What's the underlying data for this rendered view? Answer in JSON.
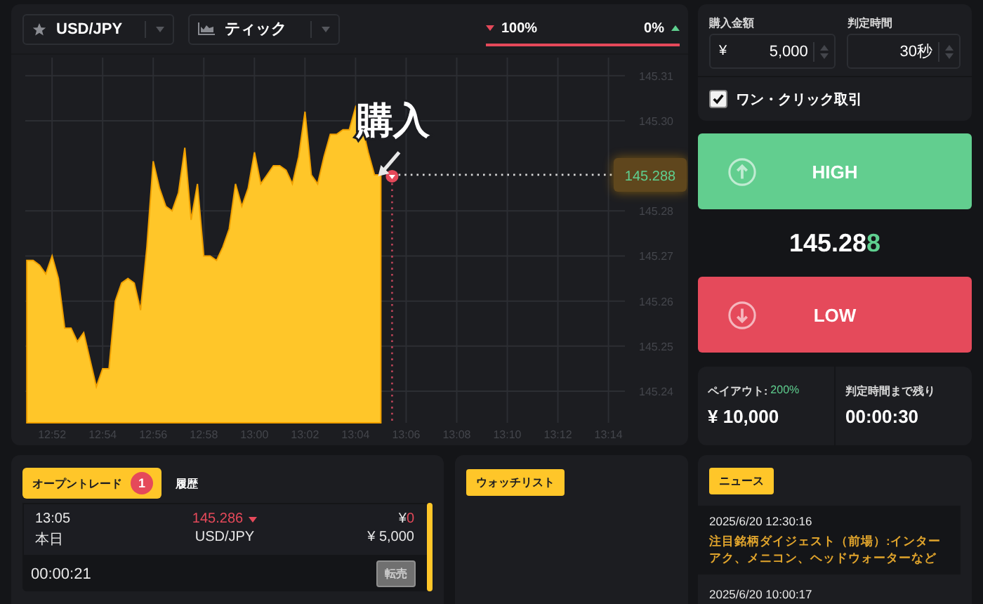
{
  "pair_select": {
    "label": "USD/JPY"
  },
  "chart_type_select": {
    "label": "ティック"
  },
  "sentiment": {
    "low": "100%",
    "high": "0%",
    "level": 1
  },
  "chart": {
    "purchase_label": "購入",
    "price_tag": "145.288",
    "chart_data": {
      "type": "area",
      "grid": true,
      "ylim": [
        145.233,
        145.314
      ],
      "categories": [
        null,
        null,
        null,
        null,
        "12:52",
        null,
        null,
        null,
        null,
        null,
        null,
        null,
        "12:54",
        null,
        null,
        null,
        null,
        null,
        null,
        null,
        "12:56",
        null,
        null,
        null,
        null,
        null,
        null,
        null,
        "12:58",
        null,
        null,
        null,
        null,
        null,
        null,
        null,
        "13:00",
        null,
        null,
        null,
        null,
        null,
        null,
        null,
        "13:02",
        null,
        null,
        null,
        null,
        null,
        null,
        null,
        "13:04",
        null,
        null,
        null,
        null,
        null,
        null,
        null,
        "13:06",
        null,
        null,
        null,
        null,
        null,
        null,
        null,
        "13:08",
        null,
        null,
        null,
        null,
        null,
        null,
        null,
        "13:10",
        null,
        null,
        null,
        null,
        null,
        null,
        null,
        "13:12",
        null,
        null,
        null,
        null,
        null,
        null,
        null,
        "13:14",
        null,
        null
      ],
      "yticks": [
        145.24,
        145.25,
        145.26,
        145.27,
        145.28,
        {
          "value": 145.3,
          "label": "145.30"
        },
        145.31
      ],
      "series": [
        {
          "color": "#ffc629",
          "values": [
            145.269,
            145.269,
            145.268,
            145.266,
            145.27,
            145.265,
            145.254,
            145.254,
            145.251,
            145.253,
            145.247,
            145.241,
            145.245,
            145.245,
            145.26,
            145.264,
            145.265,
            145.264,
            145.258,
            145.272,
            145.291,
            145.285,
            145.281,
            145.28,
            145.284,
            145.294,
            145.278,
            145.286,
            145.27,
            145.27,
            145.269,
            145.272,
            145.276,
            145.286,
            145.281,
            145.285,
            145.293,
            145.286,
            145.288,
            145.29,
            145.29,
            145.289,
            145.286,
            145.292,
            145.302,
            145.288,
            145.286,
            145.292,
            145.297,
            145.297,
            145.298,
            145.298,
            145.303,
            145.299,
            145.293,
            145.288,
            145.288,
            null,
            null,
            null,
            null,
            null,
            null,
            null,
            null,
            null,
            null,
            null,
            null,
            null,
            null,
            null,
            null,
            null,
            null,
            null,
            null,
            null,
            null,
            null,
            null,
            null,
            null,
            null,
            null,
            null,
            null,
            null,
            null,
            null,
            null,
            null,
            null,
            null,
            null
          ]
        }
      ]
    }
  },
  "order": {
    "amount_label": "購入金額",
    "currency": "¥",
    "amount": "5,000",
    "duration_label": "判定時間",
    "duration": "30秒",
    "one_click": {
      "label": "ワン・クリック取引",
      "checked": true
    }
  },
  "high_button": "HIGH",
  "price": {
    "main": "145.28",
    "last": "8"
  },
  "low_button": "LOW",
  "payout": {
    "label": "ペイアウト:",
    "rate": "200%",
    "amount": "¥ 10,000"
  },
  "remaining": {
    "label": "判定時間まで残り",
    "time": "00:00:30"
  },
  "trades_panel": {
    "tabs": [
      {
        "label": "オープントレード",
        "badge": "1",
        "selected": true
      },
      {
        "label": "履歴",
        "selected": false
      }
    ],
    "trades": [
      {
        "time": "13:05",
        "day": "本日",
        "price": "145.286",
        "price_falling": true,
        "pair": "USD/JPY",
        "profit_currency": "¥",
        "profit": "0",
        "amount": "¥ 5,000",
        "countdown": "00:00:21",
        "action": "転売"
      }
    ]
  },
  "watchlist": {
    "title": "ウォッチリスト"
  },
  "news": {
    "title": "ニュース",
    "items": [
      {
        "time": "2025/6/20 12:30:16",
        "title": "注目銘柄ダイジェスト（前場）:インターアク、メニコン、ヘッドウォーターなど"
      },
      {
        "time": "2025/6/20 10:00:17"
      }
    ]
  }
}
